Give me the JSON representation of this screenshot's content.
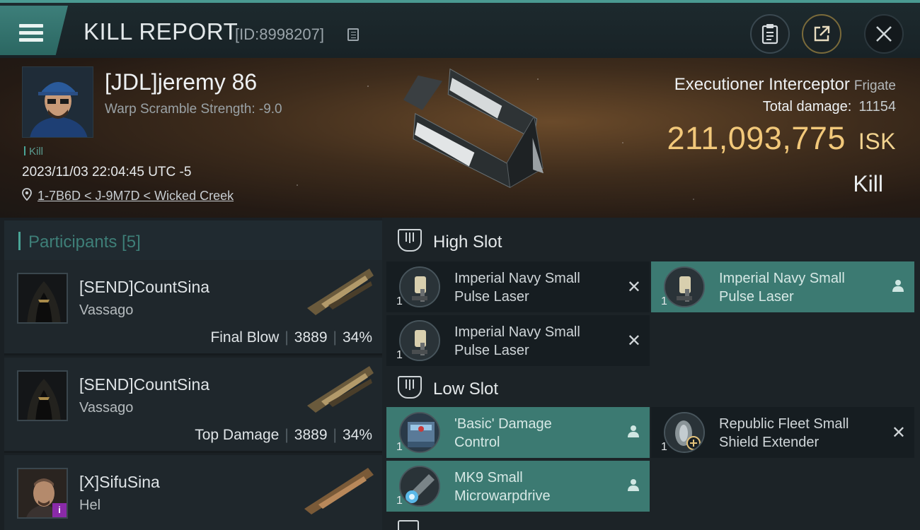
{
  "header": {
    "title": "KILL REPORT",
    "report_id": "[ID:8998207]",
    "icons": [
      "menu-icon",
      "copy-icon",
      "clipboard-icon",
      "share-icon",
      "close-icon"
    ]
  },
  "victim": {
    "name": "[JDL]jeremy 86",
    "subtitle": "Warp Scramble Strength: -9.0",
    "tag": "Kill",
    "datetime": "2023/11/03 22:04:45 UTC -5",
    "location": "1-7B6D < J-9M7D < Wicked Creek",
    "ship_name": "Executioner Interceptor",
    "ship_class": "Frigate",
    "total_damage_label": "Total damage:",
    "total_damage": "11154",
    "isk_value": "211,093,775",
    "isk_unit": "ISK",
    "result": "Kill"
  },
  "participants": {
    "title": "Participants [5]",
    "rows": [
      {
        "name": "[SEND]CountSina",
        "ship": "Vassago",
        "role": "Final Blow",
        "damage": "3889",
        "percent": "34%"
      },
      {
        "name": "[SEND]CountSina",
        "ship": "Vassago",
        "role": "Top Damage",
        "damage": "3889",
        "percent": "34%"
      },
      {
        "name": "[X]SifuSina",
        "ship": "Hel",
        "role": "",
        "damage": "",
        "percent": ""
      }
    ]
  },
  "fitting": {
    "high_slot_label": "High Slot",
    "low_slot_label": "Low Slot",
    "high_slot": [
      {
        "qty": "1",
        "name_line1": "Imperial Navy Small",
        "name_line2": "Pulse Laser",
        "status": "destroyed"
      },
      {
        "qty": "1",
        "name_line1": "Imperial Navy Small",
        "name_line2": "Pulse Laser",
        "status": "dropped"
      },
      {
        "qty": "1",
        "name_line1": "Imperial Navy Small",
        "name_line2": "Pulse Laser",
        "status": "destroyed"
      }
    ],
    "low_slot": [
      {
        "qty": "1",
        "name_line1": "'Basic' Damage",
        "name_line2": "Control",
        "status": "dropped"
      },
      {
        "qty": "1",
        "name_line1": "Republic Fleet Small",
        "name_line2": "Shield Extender",
        "status": "destroyed"
      },
      {
        "qty": "1",
        "name_line1": "MK9 Small",
        "name_line2": "Microwarpdrive",
        "status": "dropped"
      }
    ]
  },
  "colors": {
    "accent_teal": "#4aa597",
    "isk_gold": "#f2c87a",
    "dropped_bg": "#3c7a72"
  }
}
